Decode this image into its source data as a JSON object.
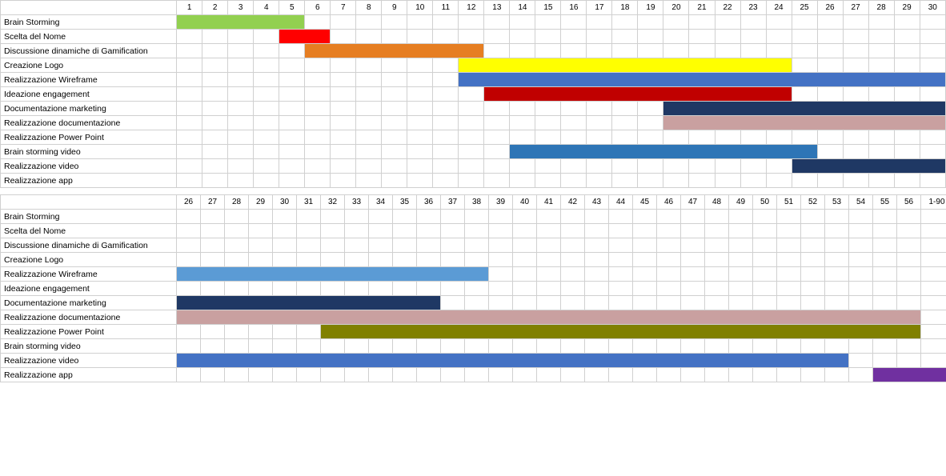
{
  "section1": {
    "headers": [
      "1",
      "2",
      "3",
      "4",
      "5",
      "6",
      "7",
      "8",
      "9",
      "10",
      "11",
      "12",
      "13",
      "14",
      "15",
      "16",
      "17",
      "18",
      "19",
      "20",
      "21",
      "22",
      "23",
      "24",
      "25",
      "26",
      "27",
      "28",
      "29",
      "30"
    ],
    "rows": [
      {
        "label": "Brain Storming",
        "bars": [
          {
            "start": 1,
            "end": 5,
            "color": "green"
          }
        ]
      },
      {
        "label": "Scelta del Nome",
        "bars": [
          {
            "start": 5,
            "end": 6,
            "color": "red-bright"
          }
        ]
      },
      {
        "label": "Discussione dinamiche di Gamification",
        "bars": [
          {
            "start": 6,
            "end": 12,
            "color": "orange"
          }
        ]
      },
      {
        "label": "Creazione Logo",
        "bars": [
          {
            "start": 12,
            "end": 24,
            "color": "yellow"
          }
        ]
      },
      {
        "label": "Realizzazione Wireframe",
        "bars": [
          {
            "start": 12,
            "end": 30,
            "color": "blue-steel"
          }
        ]
      },
      {
        "label": "Ideazione engagement",
        "bars": [
          {
            "start": 13,
            "end": 24,
            "color": "dark-red"
          }
        ]
      },
      {
        "label": "Documentazione marketing",
        "bars": [
          {
            "start": 20,
            "end": 30,
            "color": "dark-navy"
          }
        ]
      },
      {
        "label": "Realizzazione documentazione",
        "bars": [
          {
            "start": 20,
            "end": 30,
            "color": "pink-brown"
          }
        ]
      },
      {
        "label": "Realizzazione Power Point",
        "bars": []
      },
      {
        "label": "Brain storming video",
        "bars": [
          {
            "start": 14,
            "end": 25,
            "color": "blue-medium"
          }
        ]
      },
      {
        "label": "Realizzazione video",
        "bars": [
          {
            "start": 25,
            "end": 30,
            "color": "navy-dark"
          }
        ]
      },
      {
        "label": "Realizzazione app",
        "bars": []
      }
    ]
  },
  "section2": {
    "headers": [
      "26",
      "27",
      "28",
      "29",
      "30",
      "31",
      "32",
      "33",
      "34",
      "35",
      "36",
      "37",
      "38",
      "39",
      "40",
      "41",
      "42",
      "43",
      "44",
      "45",
      "46",
      "47",
      "48",
      "49",
      "50",
      "51",
      "52",
      "53",
      "54",
      "55",
      "56",
      "1-90"
    ],
    "rows": [
      {
        "label": "Brain Storming",
        "bars": []
      },
      {
        "label": "Scelta del Nome",
        "bars": []
      },
      {
        "label": "Discussione dinamiche di Gamification",
        "bars": []
      },
      {
        "label": "Creazione Logo",
        "bars": []
      },
      {
        "label": "Realizzazione Wireframe",
        "bars": [
          {
            "start": 1,
            "end": 13,
            "color": "blue-light"
          }
        ]
      },
      {
        "label": "Ideazione engagement",
        "bars": []
      },
      {
        "label": "Documentazione marketing",
        "bars": [
          {
            "start": 1,
            "end": 11,
            "color": "dark-navy"
          }
        ]
      },
      {
        "label": "Realizzazione documentazione",
        "bars": [
          {
            "start": 1,
            "end": 31,
            "color": "pink-brown"
          }
        ]
      },
      {
        "label": "Realizzazione Power Point",
        "bars": [
          {
            "start": 7,
            "end": 31,
            "color": "olive"
          }
        ]
      },
      {
        "label": "Brain storming video",
        "bars": []
      },
      {
        "label": "Realizzazione video",
        "bars": [
          {
            "start": 1,
            "end": 28,
            "color": "blue-steel"
          }
        ]
      },
      {
        "label": "Realizzazione app",
        "bars": [
          {
            "start": 30,
            "end": 32,
            "color": "purple"
          }
        ]
      }
    ]
  }
}
